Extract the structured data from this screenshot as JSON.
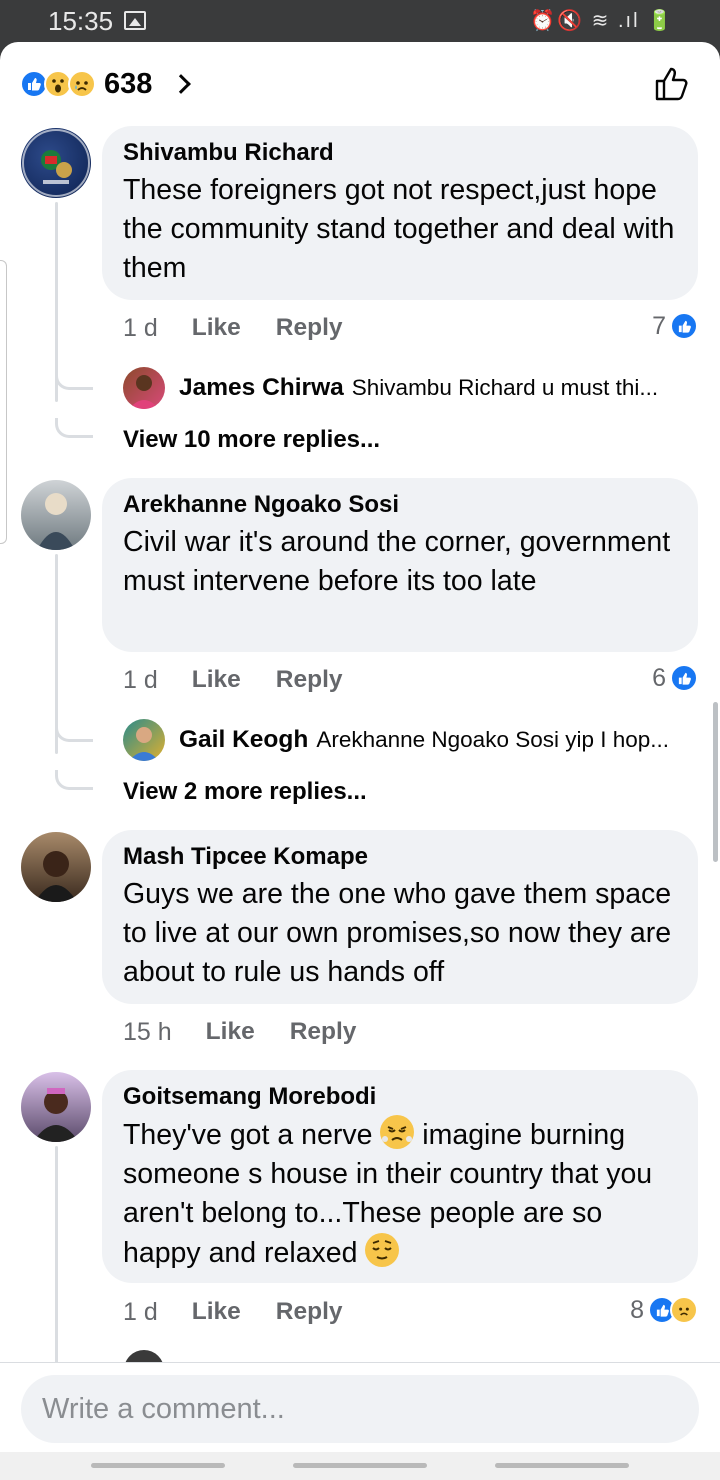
{
  "status_bar": {
    "time": "15:35",
    "icons": "⏰🔇 ≋ .ıl 🔋"
  },
  "header": {
    "reaction_count": "638",
    "reactions": [
      "like",
      "wow",
      "sad"
    ]
  },
  "comments": [
    {
      "author": "Shivambu Richard",
      "text": "These foreigners got not respect,just hope the community stand together and deal with them",
      "time": "1 d",
      "like_label": "Like",
      "reply_label": "Reply",
      "reaction_count": "7",
      "reply_preview": {
        "author": "James Chirwa",
        "text": "Shivambu Richard u must thi..."
      },
      "view_more": "View 10 more replies..."
    },
    {
      "author": "Arekhanne Ngoako Sosi",
      "text": "Civil war it's around the corner, government must intervene before its too late",
      "time": "1 d",
      "like_label": "Like",
      "reply_label": "Reply",
      "reaction_count": "6",
      "reply_preview": {
        "author": "Gail Keogh",
        "text": "Arekhanne Ngoako Sosi yip I hop..."
      },
      "view_more": "View 2 more replies..."
    },
    {
      "author": "Mash Tipcee Komape",
      "text": "Guys we are the one who gave them space to live at our own promises,so now they are about to rule us hands off",
      "time": "15 h",
      "like_label": "Like",
      "reply_label": "Reply"
    },
    {
      "author": "Goitsemang Morebodi",
      "text_part1": "They've got a nerve",
      "text_part2": "imagine burning someone s house in their country that you aren't belong to...These people are so happy and relaxed",
      "time": "1 d",
      "like_label": "Like",
      "reply_label": "Reply",
      "reaction_count": "8"
    }
  ],
  "composer": {
    "placeholder": "Write a comment..."
  },
  "colors": {
    "accent": "#1877f2",
    "bubble": "#f0f2f5",
    "secondary_text": "#65676b"
  }
}
